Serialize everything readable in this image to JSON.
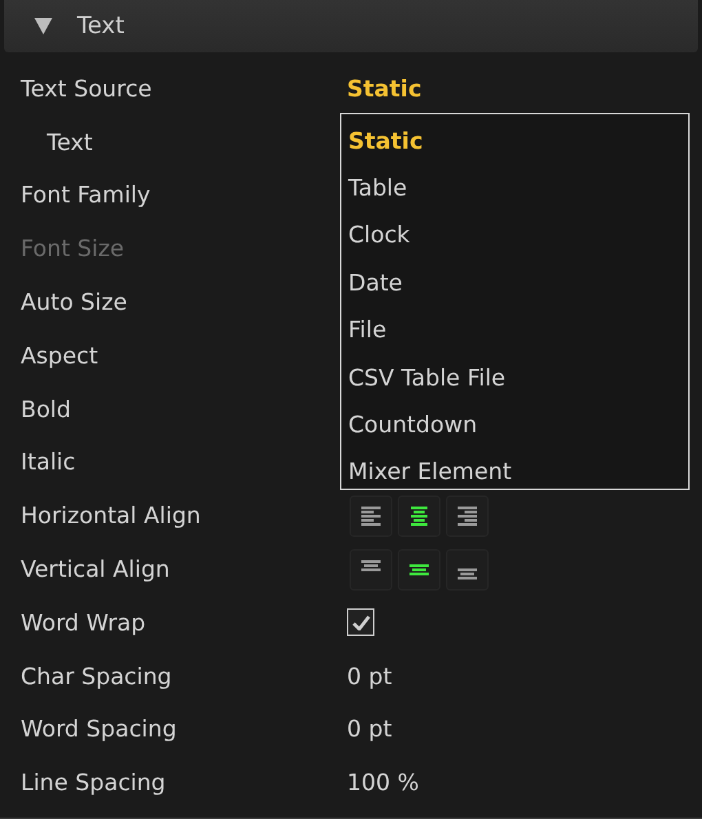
{
  "section": {
    "title": "Text",
    "expanded": true
  },
  "rows": [
    {
      "label": "Text Source",
      "kind": "dropdown",
      "value": "Static",
      "disabled": false,
      "indented": false
    },
    {
      "label": "Text",
      "kind": "none",
      "disabled": false,
      "indented": true
    },
    {
      "label": "Font Family",
      "kind": "none",
      "disabled": false,
      "indented": false
    },
    {
      "label": "Font Size",
      "kind": "none",
      "disabled": true,
      "indented": false
    },
    {
      "label": "Auto Size",
      "kind": "none",
      "disabled": false,
      "indented": false
    },
    {
      "label": "Aspect",
      "kind": "none",
      "disabled": false,
      "indented": false
    },
    {
      "label": "Bold",
      "kind": "none",
      "disabled": false,
      "indented": false
    },
    {
      "label": "Italic",
      "kind": "none",
      "disabled": false,
      "indented": false
    },
    {
      "label": "Horizontal Align",
      "kind": "align",
      "disabled": false,
      "indented": false,
      "options": [
        {
          "kind": "left",
          "selected": false
        },
        {
          "kind": "center",
          "selected": true
        },
        {
          "kind": "right",
          "selected": false
        }
      ]
    },
    {
      "label": "Vertical Align",
      "kind": "align",
      "disabled": false,
      "indented": false,
      "options": [
        {
          "kind": "top",
          "selected": false
        },
        {
          "kind": "middle",
          "selected": true
        },
        {
          "kind": "bottom",
          "selected": false
        }
      ]
    },
    {
      "label": "Word Wrap",
      "kind": "checkbox",
      "checked": true,
      "disabled": false,
      "indented": false
    },
    {
      "label": "Char Spacing",
      "kind": "value",
      "value": "0 pt",
      "disabled": false,
      "indented": false
    },
    {
      "label": "Word Spacing",
      "kind": "value",
      "value": "0 pt",
      "disabled": false,
      "indented": false
    },
    {
      "label": "Line Spacing",
      "kind": "value",
      "value": "100 %",
      "disabled": false,
      "indented": false
    }
  ],
  "dropdown": {
    "open": true,
    "options": [
      {
        "label": "Static",
        "selected": true
      },
      {
        "label": "Table",
        "selected": false
      },
      {
        "label": "Clock",
        "selected": false
      },
      {
        "label": "Date",
        "selected": false
      },
      {
        "label": "File",
        "selected": false
      },
      {
        "label": "CSV Table File",
        "selected": false
      },
      {
        "label": "Countdown",
        "selected": false
      },
      {
        "label": "Mixer Element",
        "selected": false
      }
    ]
  }
}
